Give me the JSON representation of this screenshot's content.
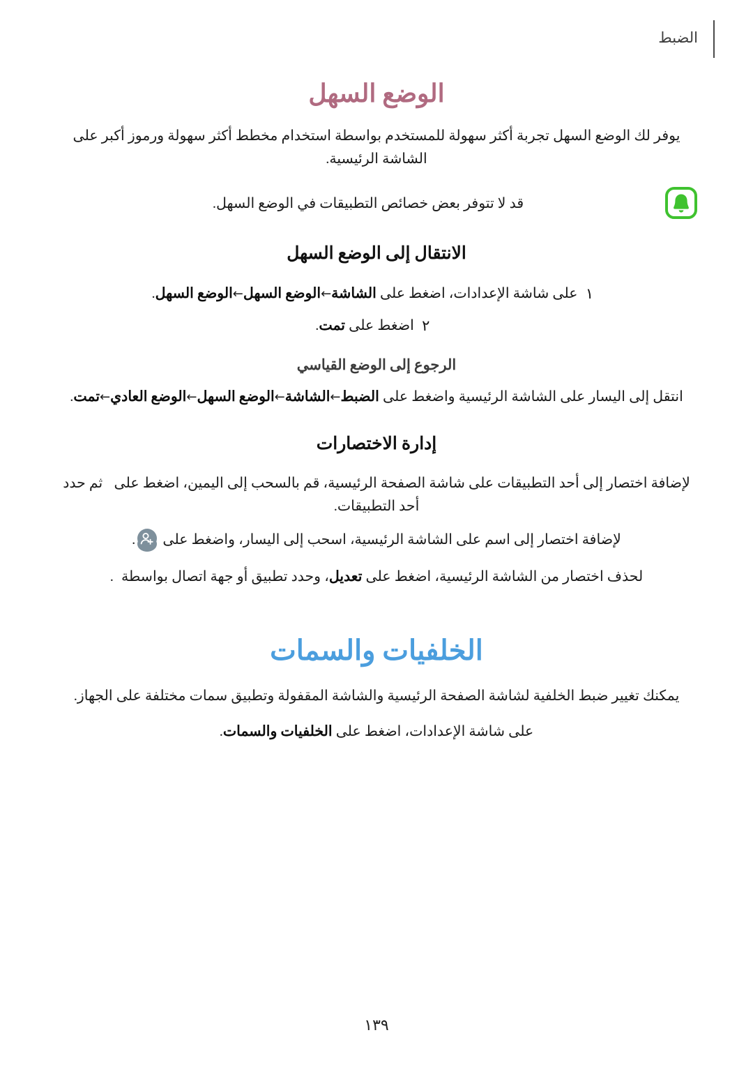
{
  "header": {
    "label": "الضبط"
  },
  "easy_mode": {
    "title": "الوضع السهل",
    "intro": "يوفر لك الوضع السهل تجربة أكثر سهولة للمستخدم بواسطة استخدام مخطط أكثر سهولة ورموز أكبر على الشاشة الرئيسية.",
    "note": {
      "icon": "bell-notice-icon",
      "text": "قد لا تتوفر بعض خصائص التطبيقات في الوضع السهل."
    },
    "switch_heading": "الانتقال إلى الوضع السهل",
    "steps": [
      {
        "number": "١",
        "prefix": "على شاشة الإعدادات، اضغط على ",
        "b1": "الشاشة",
        "arrow1": "←",
        "b2": "الوضع السهل",
        "arrow2": "←",
        "b3": "الوضع السهل",
        "suffix": "."
      },
      {
        "number": "٢",
        "prefix": "اضغط على ",
        "b1": "تمت",
        "suffix": "."
      }
    ],
    "revert_heading": "الرجوع إلى الوضع القياسي",
    "revert_text": {
      "prefix": "انتقل إلى اليسار على الشاشة الرئيسية واضغط على ",
      "b1": "الضبط",
      "arrow1": "←",
      "b2": "الشاشة",
      "arrow2": "←",
      "b3": "الوضع السهل",
      "arrow3": "←",
      "b4": "الوضع العادي",
      "arrow4": "←",
      "b5": "تمت",
      "suffix": "."
    },
    "shortcuts_heading": "إدارة الاختصارات",
    "shortcut_add_app": {
      "part1": "لإضافة اختصار إلى أحد التطبيقات على شاشة الصفحة الرئيسية، قم بالسحب إلى اليمين، اضغط على ",
      "icon": "plus-button-icon",
      "part2": " ثم حدد أحد التطبيقات."
    },
    "shortcut_add_contact": {
      "part1": "لإضافة اختصار إلى اسم على الشاشة الرئيسية، اسحب إلى اليسار، واضغط على ",
      "icon": "add-contact-icon",
      "part2": "."
    },
    "shortcut_delete": {
      "part1": "لحذف اختصار من الشاشة الرئيسية، اضغط على ",
      "b1": "تعديل",
      "part2": "، وحدد تطبيق أو جهة اتصال بواسطة ",
      "icon": "minus-circle-icon",
      "part3": "."
    }
  },
  "wallpapers": {
    "title": "الخلفيات والسمات",
    "intro": "يمكنك تغيير ضبط الخلفية لشاشة الصفحة الرئيسية والشاشة المقفولة وتطبيق سمات مختلفة على الجهاز.",
    "instruction": {
      "prefix": "على شاشة الإعدادات، اضغط على ",
      "b1": "الخلفيات والسمات",
      "suffix": "."
    }
  },
  "footer": {
    "page_number": "١٣٩"
  },
  "colors": {
    "title_rose": "#b06a80",
    "title_blue": "#4b9ede",
    "note_green": "#3fc22f",
    "plus_blue": "#5d7fa3",
    "contact_gray": "#7e909c",
    "minus_red": "#e0685f"
  }
}
